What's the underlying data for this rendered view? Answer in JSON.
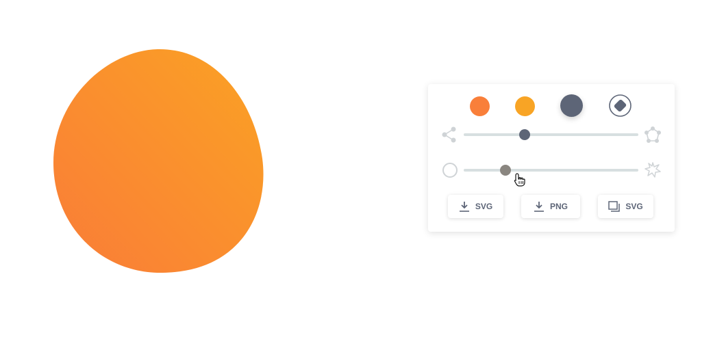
{
  "colors": {
    "swatch_1": "#f97f3a",
    "swatch_2": "#f8a425",
    "swatch_3": "#5d6577",
    "blob_start": "#f97c38",
    "blob_end": "#fba224",
    "track": "#d7dfe0",
    "slider_thumb_1": "#5d6577",
    "slider_thumb_2": "#8a8680",
    "icon_light": "#cfd3d6"
  },
  "sliders": {
    "complexity": {
      "value": 0.35,
      "min_icon": "share-nodes-icon",
      "max_icon": "polygon-nodes-icon"
    },
    "contrast": {
      "value": 0.24,
      "min_icon": "circle-outline-icon",
      "max_icon": "star-burst-icon"
    }
  },
  "buttons": {
    "download_svg": {
      "icon": "download-icon",
      "label": "SVG"
    },
    "download_png": {
      "icon": "download-icon",
      "label": "PNG"
    },
    "copy_svg": {
      "icon": "copy-icon",
      "label": "SVG"
    }
  },
  "random_button": {
    "icon": "randomize-icon"
  }
}
